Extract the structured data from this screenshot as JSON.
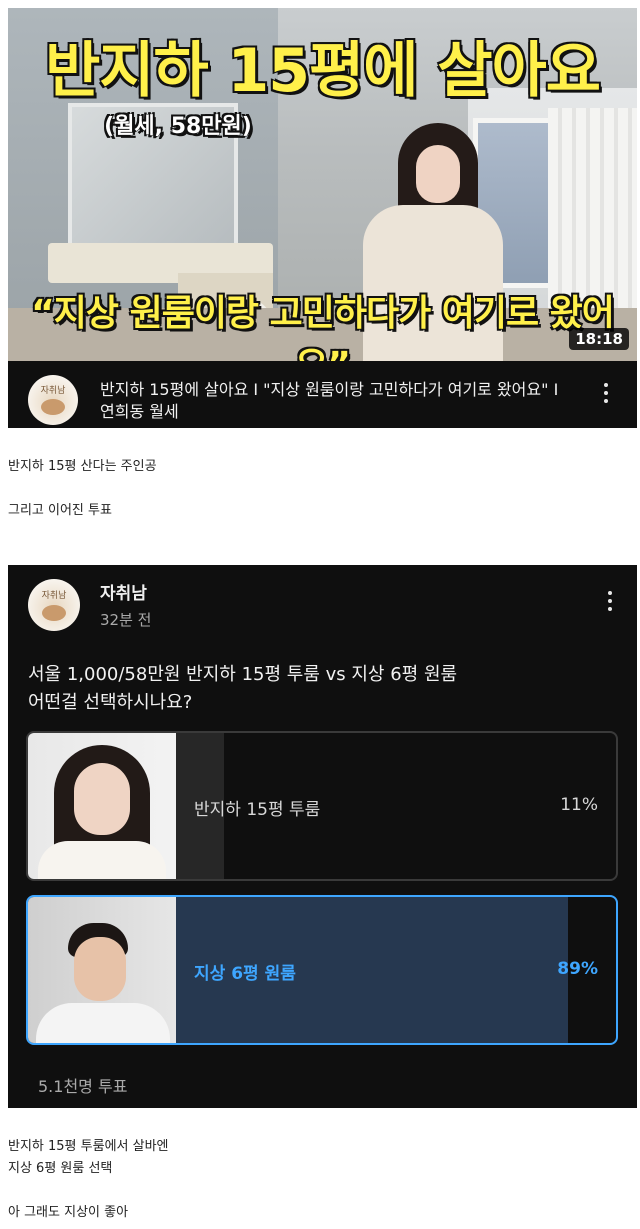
{
  "video": {
    "thumbnail_title": "반지하 15평에 살아요",
    "thumbnail_subtitle": "(월세, 58만원)",
    "thumbnail_quote": "“지상 원룸이랑 고민하다가 여기로 왔어요”",
    "duration": "18:18",
    "channel_avatar_text": "자취남",
    "title": "반지하 15평에 살아요 I \"지상 원룸이랑 고민하다가 여기로 왔어요\" I 연희동 월세"
  },
  "caption1": "반지하 15평 산다는 주인공",
  "caption2": "그리고 이어진 투표",
  "poll": {
    "avatar_text": "자취남",
    "channel": "자취남",
    "time": "32분 전",
    "question_line1": "서울 1,000/58만원 반지하 15평 투룸 vs 지상 6평 원룸",
    "question_line2": "어떤걸 선택하시나요?",
    "options": [
      {
        "label": "반지하 15평 투룸",
        "percent_text": "11%",
        "percent": 11,
        "selected": false
      },
      {
        "label": "지상 6평 원룸",
        "percent_text": "89%",
        "percent": 89,
        "selected": true
      }
    ],
    "votes": "5.1천명 투표",
    "accent_color": "#3ea6ff"
  },
  "caption3": "반지하 15평 투룸에서 살바엔",
  "caption4": "지상 6평 원룸 선택",
  "caption5": "아 그래도 지상이 좋아"
}
